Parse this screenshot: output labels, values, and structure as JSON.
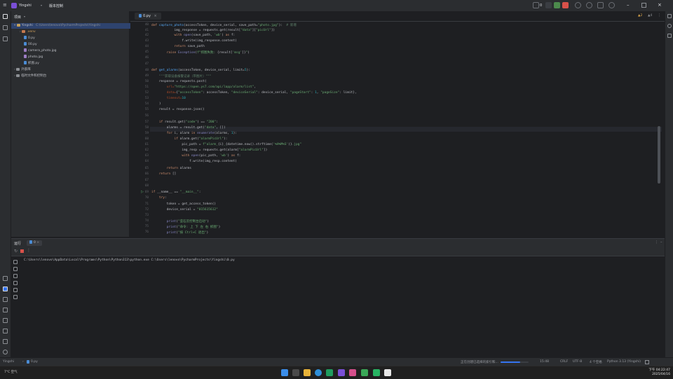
{
  "titlebar": {
    "menu_glyph": "≡",
    "project_name": "Yingshi",
    "run_config": "版本控制",
    "run_count": "0"
  },
  "project_panel": {
    "title": "项目",
    "items": [
      {
        "label": "Yingshi",
        "detail": "C:\\Users\\lenovo\\PycharmProjects\\Yingshi",
        "kind": "folder",
        "indent": 0
      },
      {
        "label": ".venv",
        "detail": "",
        "kind": "folder-venv",
        "indent": 1
      },
      {
        "label": "0.py",
        "detail": "",
        "kind": "py",
        "indent": 1
      },
      {
        "label": "00.py",
        "detail": "",
        "kind": "py",
        "indent": 1
      },
      {
        "label": "camera_photo.jpg",
        "detail": "",
        "kind": "img",
        "indent": 1
      },
      {
        "label": "photo.jpg",
        "detail": "",
        "kind": "img",
        "indent": 1
      },
      {
        "label": "抓图.py",
        "detail": "",
        "kind": "py",
        "indent": 1
      },
      {
        "label": "外部库",
        "detail": "",
        "kind": "folder",
        "indent": 0
      },
      {
        "label": "临时文件和控制台",
        "detail": "",
        "kind": "folder",
        "indent": 0
      }
    ]
  },
  "editor": {
    "tab_label": "0.py",
    "inspection_warnings": "2",
    "inspection_weak": "4"
  },
  "run_panel": {
    "title": "运行",
    "tab_label": "0",
    "output_line": "C:\\Users\\lenovo\\AppData\\Local\\Programs\\Python\\Python313\\python.exe C:\\Users\\lenovo\\PycharmProjects\\Yingshi\\0.py"
  },
  "statusbar": {
    "breadcrumb_project": "Yingshi",
    "breadcrumb_file": "0.py",
    "progress_text": "正在创建已选择的索引和...",
    "position": "15:48",
    "line_sep": "CRLF",
    "encoding": "UTF-8",
    "indent": "4 个空格",
    "interpreter": "Python 3.13 (Yingshi)",
    "progress_fraction": 0.7
  },
  "taskbar": {
    "weather": "7°C 空气",
    "time": "下午 04:22:47",
    "date": "2025/04/16"
  }
}
